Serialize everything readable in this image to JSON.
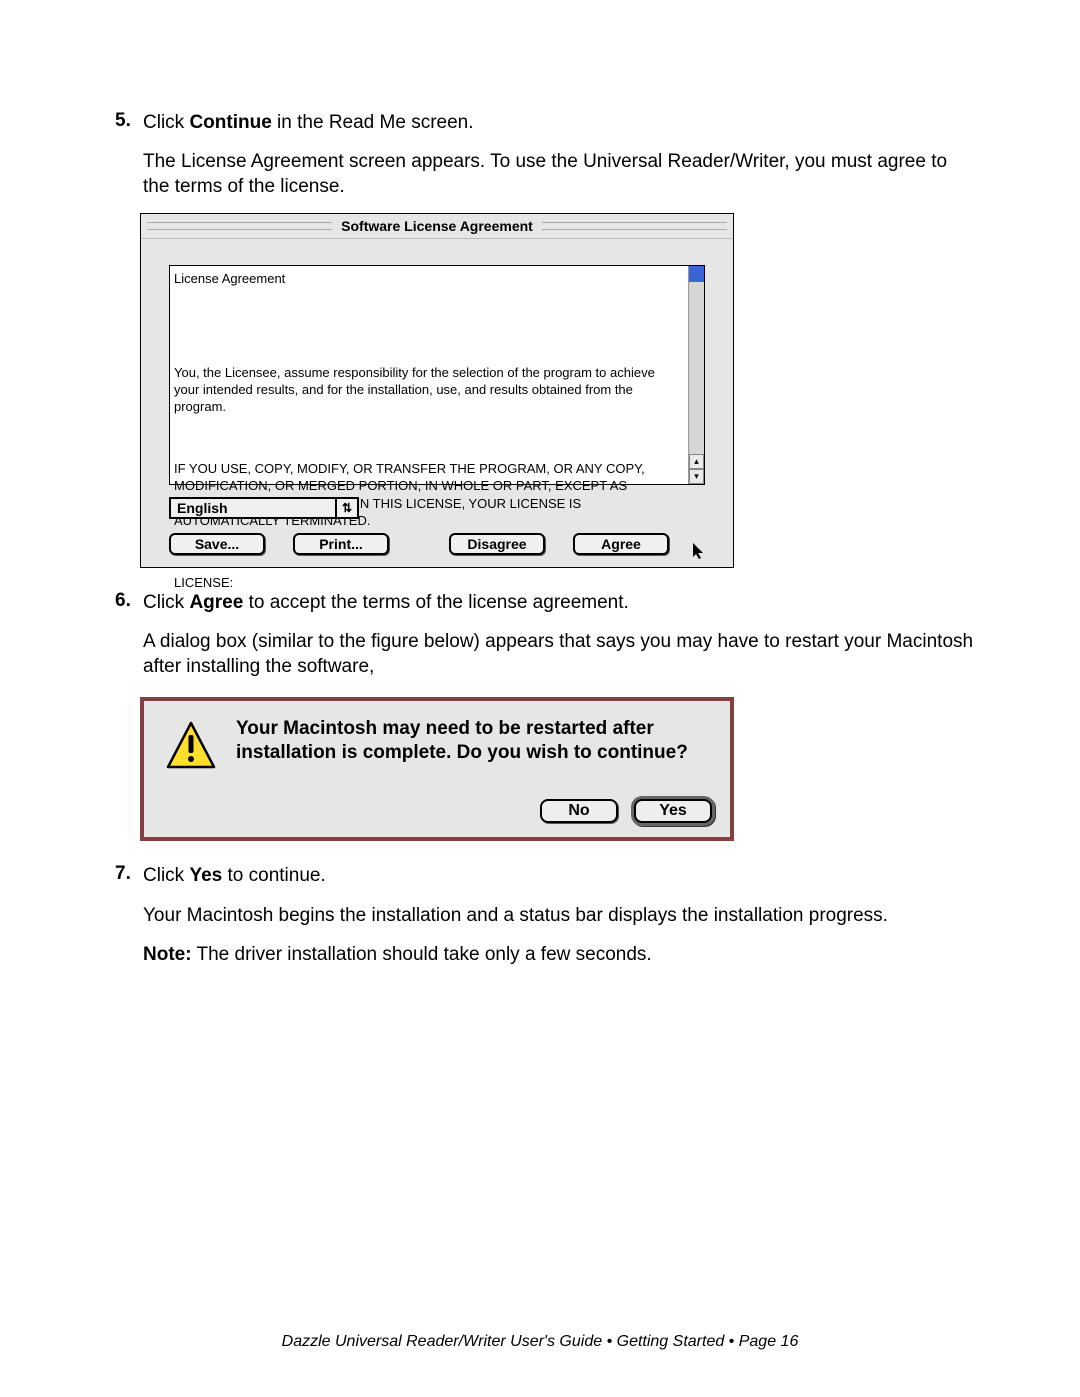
{
  "steps": {
    "s5": {
      "num": "5.",
      "line1_a": "Click ",
      "line1_b": "Continue",
      "line1_c": " in the Read Me screen.",
      "line2": "The License Agreement screen appears. To use the Universal Reader/Writer, you must agree to the terms of the license."
    },
    "s6": {
      "num": "6.",
      "line1_a": "Click ",
      "line1_b": "Agree",
      "line1_c": " to accept the terms of the license agreement.",
      "line2": "A dialog box (similar to the figure below) appears that says you may have to restart your Macintosh after installing the software,"
    },
    "s7": {
      "num": "7.",
      "line1_a": "Click ",
      "line1_b": "Yes",
      "line1_c": " to continue.",
      "line2": "Your Macintosh begins the installation and a status bar displays the installation progress.",
      "note_b": "Note:",
      "note_rest": " The driver installation should take only a few seconds."
    }
  },
  "license": {
    "title": "Software License Agreement",
    "heading": "License Agreement",
    "p1": "You, the Licensee, assume responsibility for the selection of the program to achieve your intended results, and for the installation, use, and results obtained from the program.",
    "p2": "IF YOU USE, COPY, MODIFY, OR TRANSFER THE PROGRAM, OR ANY COPY, MODIFICATION, OR MERGED PORTION, IN WHOLE OR PART, EXCEPT AS EXPRESSLY PROVIDED FOR IN THIS LICENSE, YOUR LICENSE IS AUTOMATICALLY TERMINATED.",
    "p3": "LICENSE:",
    "language": "English",
    "btn_save": "Save...",
    "btn_print": "Print...",
    "btn_disagree": "Disagree",
    "btn_agree": "Agree"
  },
  "restart": {
    "msg": "Your Macintosh may need to be restarted after installation is complete. Do you wish to continue?",
    "btn_no": "No",
    "btn_yes": "Yes"
  },
  "footer": "Dazzle Universal Reader/Writer User's Guide • Getting Started • Page 16"
}
